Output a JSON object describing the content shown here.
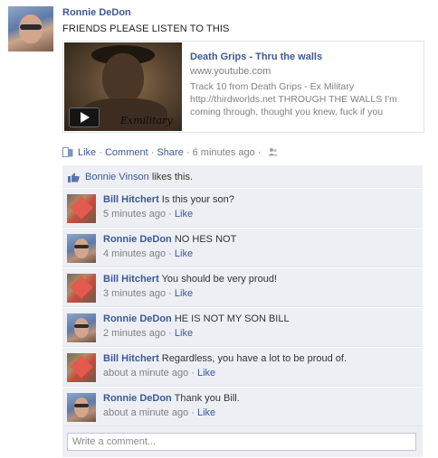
{
  "post": {
    "author": "Ronnie DeDon",
    "status": "FRIENDS PLEASE LISTEN TO THIS"
  },
  "share": {
    "title": "Death Grips - Thru the walls",
    "url": "www.youtube.com",
    "description": "Track 10 from Death Grips - Ex Military http://thirdworlds.net THROUGH THE WALLS I'm coming through, thought you knew, fuck if you",
    "thumbnail_text": "Exmilitary"
  },
  "actions": {
    "like": "Like",
    "comment": "Comment",
    "share": "Share",
    "sep": "·",
    "time": "6 minutes ago"
  },
  "likes": {
    "name": "Bonnie Vinson",
    "suffix": "likes this."
  },
  "comments": [
    {
      "author": "Bill Hitchert",
      "text": "Is this your son?",
      "time": "5 minutes ago",
      "like": "Like"
    },
    {
      "author": "Ronnie DeDon",
      "text": "NO HES NOT",
      "time": "4 minutes ago",
      "like": "Like"
    },
    {
      "author": "Bill Hitchert",
      "text": "You should be very proud!",
      "time": "3 minutes ago",
      "like": "Like"
    },
    {
      "author": "Ronnie DeDon",
      "text": "HE IS NOT MY SON BILL",
      "time": "2 minutes ago",
      "like": "Like"
    },
    {
      "author": "Bill Hitchert",
      "text": "Regardless, you have a lot to be proud of.",
      "time": "about a minute ago",
      "like": "Like"
    },
    {
      "author": "Ronnie DeDon",
      "text": "Thank you Bill.",
      "time": "about a minute ago",
      "like": "Like"
    }
  ],
  "composer": {
    "placeholder": "Write a comment..."
  },
  "colors": {
    "link": "#3b5998",
    "meta": "#808080",
    "comment_bg": "#edeff4"
  },
  "icons": {
    "like_action": "like-icon",
    "privacy": "friends-icon",
    "likes_row": "thumbs-up-icon",
    "play": "play-icon"
  }
}
